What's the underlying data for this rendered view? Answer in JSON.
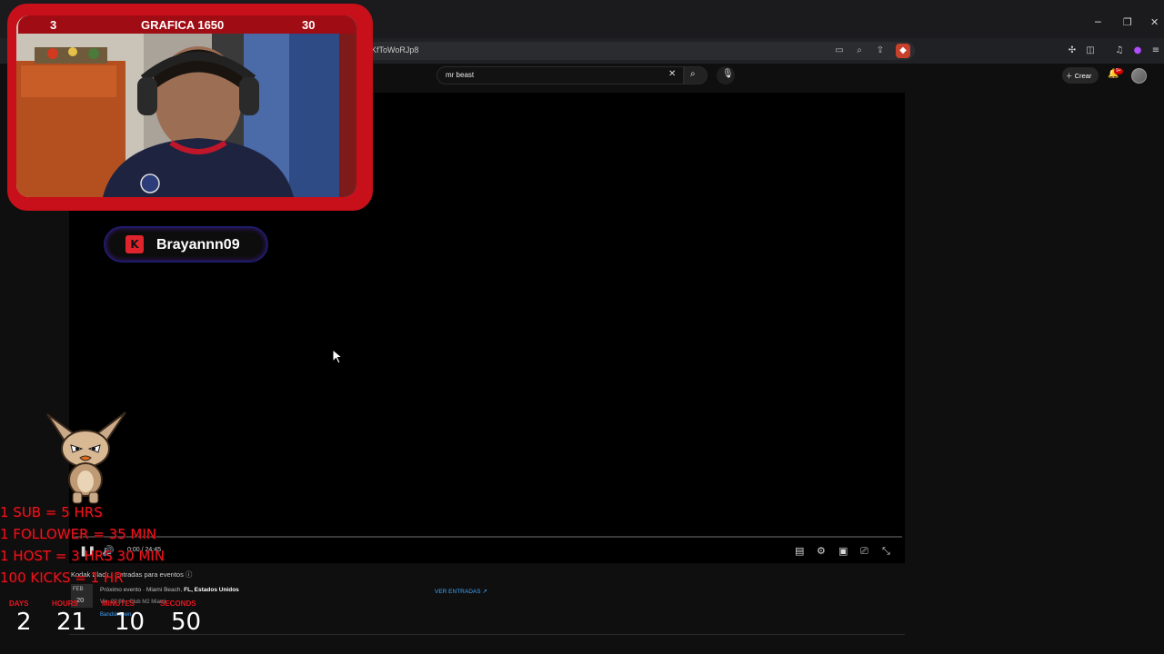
{
  "browser": {
    "url_fragment": "KfToWoRJp8",
    "window_controls": [
      "minimize-icon",
      "restore-icon",
      "close-icon"
    ],
    "address_icons": [
      "cast-icon",
      "zoom-icon",
      "share-icon",
      "brave-shield-icon"
    ],
    "extension_icons": [
      "puzzle-icon",
      "sidebar-icon",
      "music-icon",
      "extension-icon",
      "menu-icon"
    ]
  },
  "youtube": {
    "search_value": "mr beast",
    "create_label": "Crear",
    "notifications_badge": "9+"
  },
  "player": {
    "time": "0:00 / 24:45",
    "progress": 0.0
  },
  "below": {
    "ad_title": "Kodak Black - Entradas para eventos",
    "event_month": "FEB",
    "event_day": "20",
    "event_prefix": "Próximo evento · Miami Beach,",
    "event_location": "FL, Estados Unidos",
    "event_venue": "Vie, 22:00 · Club M2 Miami",
    "event_link": "Bandsintown",
    "tickets_link": "VER ENTRADAS"
  },
  "overlay": {
    "cam_left_num": "3",
    "cam_title": "GRAFICA 1650",
    "cam_right_num": "30",
    "kick_username": "Brayannn09",
    "subathon_rules": [
      "1 SUB = 5 HRS",
      "1 FOLLOWER = 35 MIN",
      "1 HOST = 3 HRS 30 MIN",
      "100 KICKS = 1 HR"
    ],
    "countdown_labels": [
      "DAYS",
      "HOURS",
      "MINUTES",
      "SECONDS"
    ],
    "countdown_values": [
      "2",
      "21",
      "10",
      "50"
    ]
  },
  "colors": {
    "overlay_red": "#e8161f",
    "frame_red": "#c8101a",
    "link_blue": "#3ea6ff",
    "kick_border": "#1e1b6a"
  }
}
